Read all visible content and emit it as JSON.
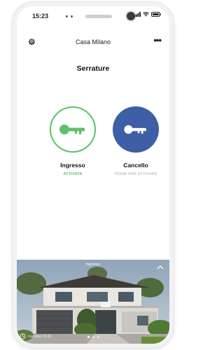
{
  "status_bar": {
    "time": "15:23"
  },
  "header": {
    "title": "Casa Milano",
    "more_label": "•••",
    "settings_icon": "gear-icon"
  },
  "section": {
    "title": "Serrature"
  },
  "locks": [
    {
      "name": "Ingresso",
      "state": "ATTIVATA",
      "icon": "key-icon",
      "color": "#5cc168"
    },
    {
      "name": "Cancello",
      "state": "PREMI PER ATTIVARE",
      "icon": "key-icon",
      "color": "#3e5fa6"
    }
  ],
  "camera": {
    "label": "Ingresso",
    "bottom_text": "Ingresso 15:23"
  },
  "colors": {
    "accent_green": "#5cc168",
    "accent_blue": "#3e5fa6",
    "inactive_text": "#c6c6c6"
  }
}
